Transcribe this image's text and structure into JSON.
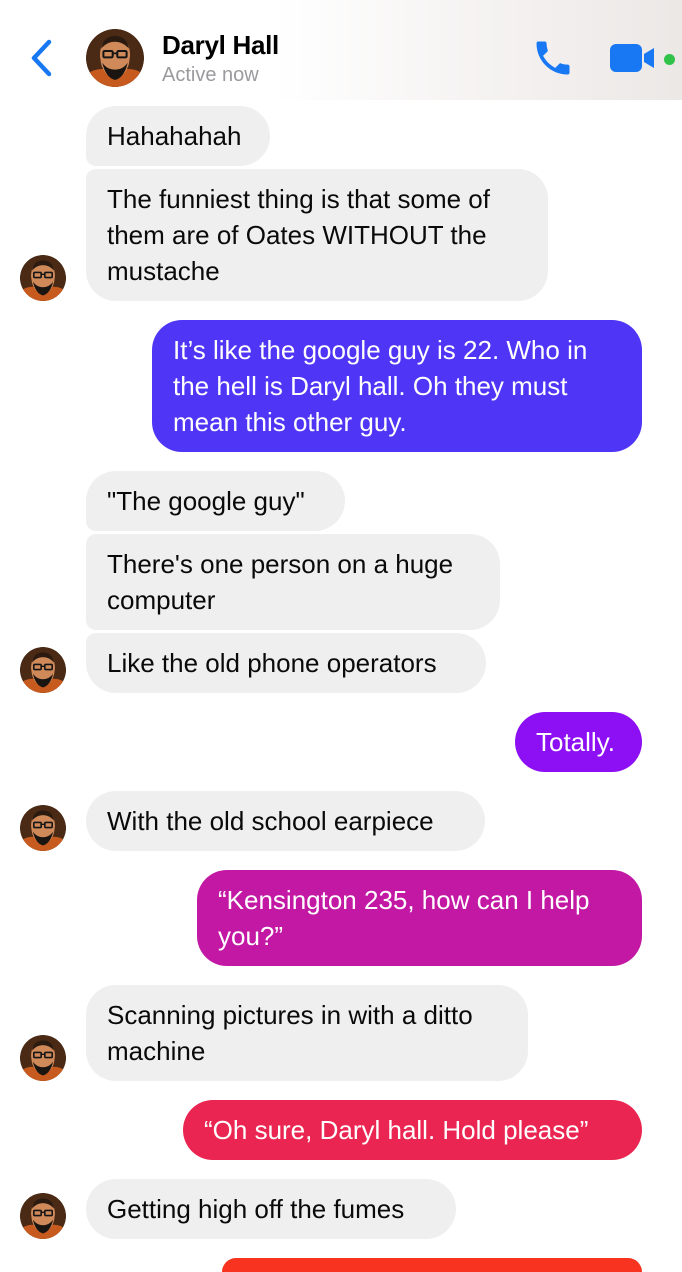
{
  "header": {
    "contact_name": "Daryl Hall",
    "status": "Active now"
  },
  "icons": {
    "back": "chevron-left-icon",
    "phone": "phone-icon",
    "video": "video-camera-icon",
    "online": "online-dot"
  },
  "colors": {
    "accent": "#1877f2",
    "incoming_bubble": "#efeff0",
    "online": "#31c24a"
  },
  "messages": [
    {
      "sender": "Daryl Hall",
      "direction": "incoming",
      "lines": [
        "Hahahahah"
      ]
    },
    {
      "sender": "Daryl Hall",
      "direction": "incoming",
      "lines": [
        "The funniest thing is that some of",
        "them are of Oates WITHOUT the",
        "mustache"
      ]
    },
    {
      "sender": "me",
      "direction": "outgoing",
      "color": "#4f35f6",
      "lines": [
        "It’s like the google guy is 22. Who in",
        "the hell is Daryl hall.  Oh they must",
        "mean this other guy."
      ]
    },
    {
      "sender": "Daryl Hall",
      "direction": "incoming",
      "lines": [
        "\"The google guy\""
      ]
    },
    {
      "sender": "Daryl Hall",
      "direction": "incoming",
      "lines": [
        "There's one person on a huge",
        "computer"
      ]
    },
    {
      "sender": "Daryl Hall",
      "direction": "incoming",
      "lines": [
        "Like the old phone operators"
      ]
    },
    {
      "sender": "me",
      "direction": "outgoing",
      "color": "#8d0ff3",
      "lines": [
        "Totally."
      ]
    },
    {
      "sender": "Daryl Hall",
      "direction": "incoming",
      "lines": [
        "With the old school earpiece"
      ]
    },
    {
      "sender": "me",
      "direction": "outgoing",
      "color": "#c218a4",
      "lines": [
        "“Kensington 235, how can I help",
        "you?”"
      ]
    },
    {
      "sender": "Daryl Hall",
      "direction": "incoming",
      "lines": [
        "Scanning pictures in with a ditto",
        "machine"
      ]
    },
    {
      "sender": "me",
      "direction": "outgoing",
      "color": "#eb2551",
      "lines": [
        "“Oh sure, Daryl hall. Hold please”"
      ]
    },
    {
      "sender": "Daryl Hall",
      "direction": "incoming",
      "lines": [
        "Getting high off the fumes"
      ]
    },
    {
      "sender": "me",
      "direction": "outgoing",
      "color": "#f8331f",
      "lines": []
    }
  ]
}
